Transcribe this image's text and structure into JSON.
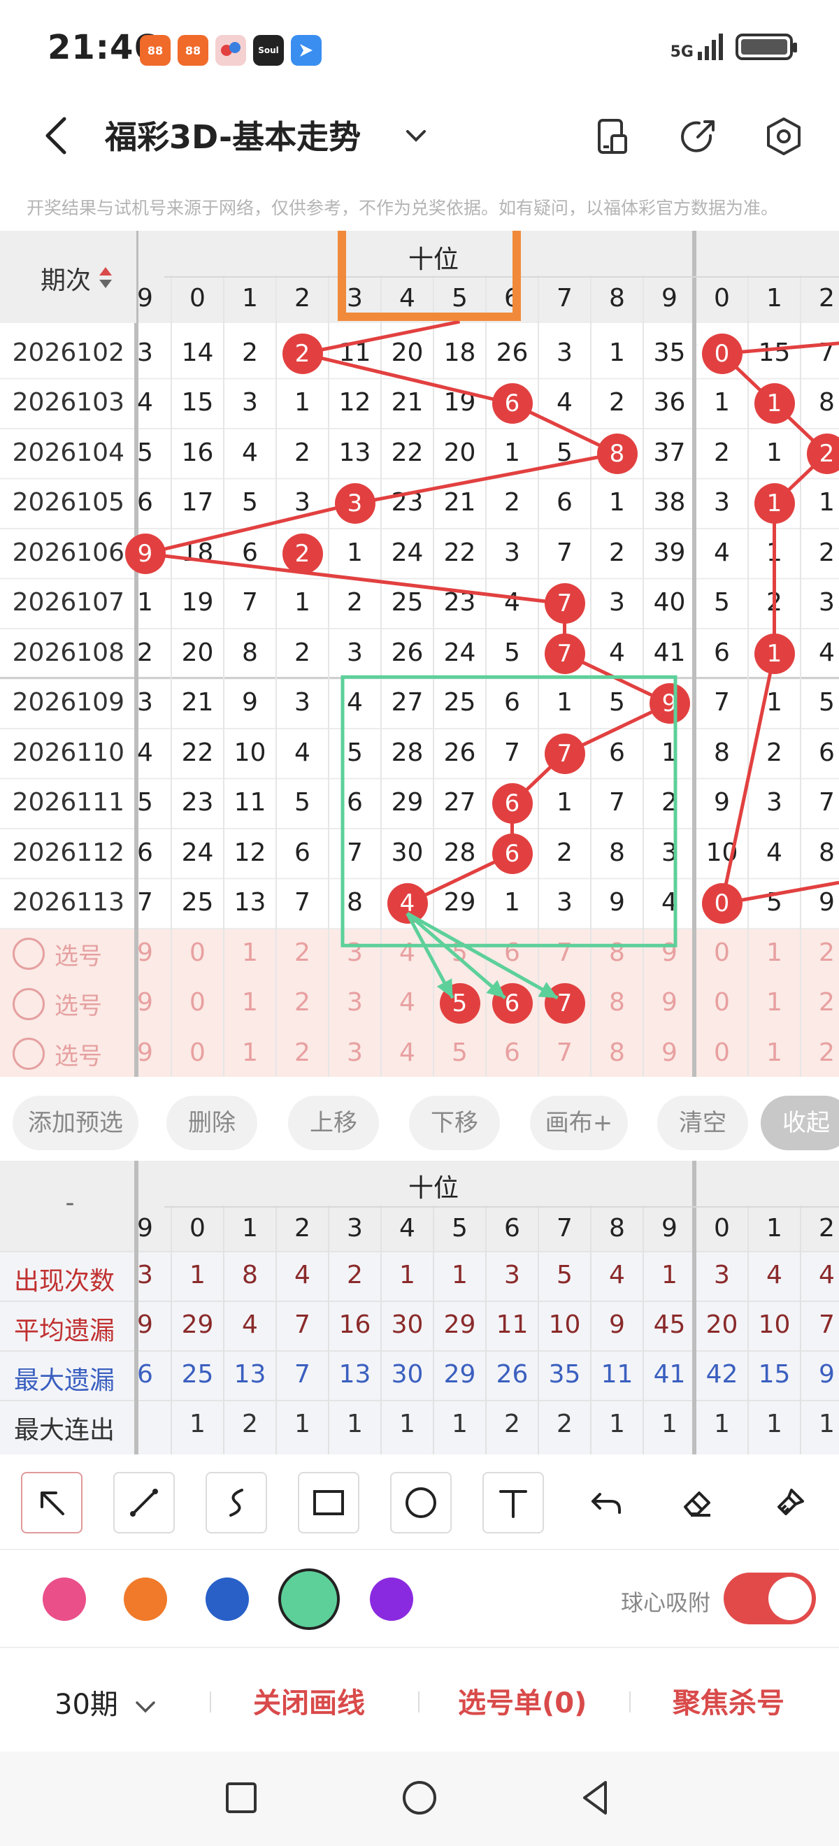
{
  "status_bar": {
    "time": "21:46",
    "network": "5G",
    "app_icons": [
      "app-icon-1",
      "app-icon-2",
      "app-icon-3",
      "soul-app-icon",
      "feishu-app-icon"
    ]
  },
  "header": {
    "title": "福彩3D-基本走势"
  },
  "notice": "开奖结果与试机号来源于网络，仅供参考，不作为兑奖依据。如有疑问，以福体彩官方数据为准。",
  "chart": {
    "period_header": "期次",
    "section_label": "十位",
    "digit_headers": [
      "9",
      "0",
      "1",
      "2",
      "3",
      "4",
      "5",
      "6",
      "7",
      "8",
      "9",
      "0",
      "1",
      "2"
    ],
    "rows": [
      {
        "period": "2026102",
        "cells": [
          "3",
          "14",
          "2",
          "2",
          "11",
          "20",
          "18",
          "26",
          "3",
          "1",
          "35",
          "0",
          "15",
          "7"
        ]
      },
      {
        "period": "2026103",
        "cells": [
          "4",
          "15",
          "3",
          "1",
          "12",
          "21",
          "19",
          "6",
          "4",
          "2",
          "36",
          "1",
          "1",
          "8"
        ]
      },
      {
        "period": "2026104",
        "cells": [
          "5",
          "16",
          "4",
          "2",
          "13",
          "22",
          "20",
          "1",
          "5",
          "8",
          "37",
          "2",
          "1",
          "2"
        ]
      },
      {
        "period": "2026105",
        "cells": [
          "6",
          "17",
          "5",
          "3",
          "3",
          "23",
          "21",
          "2",
          "6",
          "1",
          "38",
          "3",
          "1",
          "1"
        ]
      },
      {
        "period": "2026106",
        "cells": [
          "9",
          "18",
          "6",
          "2",
          "1",
          "24",
          "22",
          "3",
          "7",
          "2",
          "39",
          "4",
          "1",
          "2"
        ]
      },
      {
        "period": "2026107",
        "cells": [
          "1",
          "19",
          "7",
          "1",
          "2",
          "25",
          "23",
          "4",
          "7",
          "3",
          "40",
          "5",
          "2",
          "3"
        ]
      },
      {
        "period": "2026108",
        "cells": [
          "2",
          "20",
          "8",
          "2",
          "3",
          "26",
          "24",
          "5",
          "7",
          "4",
          "41",
          "6",
          "1",
          "4"
        ]
      },
      {
        "period": "2026109",
        "cells": [
          "3",
          "21",
          "9",
          "3",
          "4",
          "27",
          "25",
          "6",
          "1",
          "5",
          "9",
          "7",
          "1",
          "5"
        ]
      },
      {
        "period": "2026110",
        "cells": [
          "4",
          "22",
          "10",
          "4",
          "5",
          "28",
          "26",
          "7",
          "7",
          "6",
          "1",
          "8",
          "2",
          "6"
        ]
      },
      {
        "period": "2026111",
        "cells": [
          "5",
          "23",
          "11",
          "5",
          "6",
          "29",
          "27",
          "6",
          "1",
          "7",
          "2",
          "9",
          "3",
          "7"
        ]
      },
      {
        "period": "2026112",
        "cells": [
          "6",
          "24",
          "12",
          "6",
          "7",
          "30",
          "28",
          "6",
          "2",
          "8",
          "3",
          "10",
          "4",
          "8"
        ]
      },
      {
        "period": "2026113",
        "cells": [
          "7",
          "25",
          "13",
          "7",
          "8",
          "4",
          "29",
          "1",
          "3",
          "9",
          "4",
          "0",
          "5",
          "9"
        ]
      }
    ],
    "balls": [
      {
        "row": 0,
        "col": 3,
        "value": "2"
      },
      {
        "row": 0,
        "col": 11,
        "value": "0"
      },
      {
        "row": 1,
        "col": 7,
        "value": "6"
      },
      {
        "row": 1,
        "col": 12,
        "value": "1"
      },
      {
        "row": 2,
        "col": 9,
        "value": "8"
      },
      {
        "row": 2,
        "col": 13,
        "value": "2"
      },
      {
        "row": 3,
        "col": 4,
        "value": "3"
      },
      {
        "row": 3,
        "col": 12,
        "value": "1"
      },
      {
        "row": 4,
        "col": 0,
        "value": "9"
      },
      {
        "row": 4,
        "col": 3,
        "value": "2"
      },
      {
        "row": 5,
        "col": 8,
        "value": "7"
      },
      {
        "row": 6,
        "col": 8,
        "value": "7"
      },
      {
        "row": 6,
        "col": 12,
        "value": "1"
      },
      {
        "row": 7,
        "col": 10,
        "value": "9"
      },
      {
        "row": 8,
        "col": 8,
        "value": "7"
      },
      {
        "row": 9,
        "col": 7,
        "value": "6"
      },
      {
        "row": 10,
        "col": 7,
        "value": "6"
      },
      {
        "row": 11,
        "col": 5,
        "value": "4"
      },
      {
        "row": 11,
        "col": 11,
        "value": "0"
      }
    ],
    "pick_rows": [
      {
        "label": "选号",
        "cells": [
          "9",
          "0",
          "1",
          "2",
          "3",
          "4",
          "5",
          "6",
          "7",
          "8",
          "9",
          "0",
          "1",
          "2"
        ]
      },
      {
        "label": "选号",
        "cells": [
          "9",
          "0",
          "1",
          "2",
          "3",
          "4",
          "5",
          "6",
          "7",
          "8",
          "9",
          "0",
          "1",
          "2"
        ]
      },
      {
        "label": "选号",
        "cells": [
          "9",
          "0",
          "1",
          "2",
          "3",
          "4",
          "5",
          "6",
          "7",
          "8",
          "9",
          "0",
          "1",
          "2"
        ]
      }
    ],
    "pick_balls": [
      {
        "row": 1,
        "col": 6,
        "value": "5"
      },
      {
        "row": 1,
        "col": 7,
        "value": "6"
      },
      {
        "row": 1,
        "col": 8,
        "value": "7"
      }
    ]
  },
  "actions": {
    "add": "添加预选",
    "delete": "删除",
    "up": "上移",
    "down": "下移",
    "draw": "画布+",
    "clear": "清空",
    "collapse": "收起"
  },
  "stats": {
    "section_label": "十位",
    "corner": "-",
    "digit_headers": [
      "9",
      "0",
      "1",
      "2",
      "3",
      "4",
      "5",
      "6",
      "7",
      "8",
      "9",
      "0",
      "1",
      "2"
    ],
    "rows": [
      {
        "label": "出现次数",
        "color": "#c03030",
        "cells": [
          "3",
          "1",
          "8",
          "4",
          "2",
          "1",
          "1",
          "3",
          "5",
          "4",
          "1",
          "3",
          "4",
          "4"
        ]
      },
      {
        "label": "平均遗漏",
        "color": "#c03030",
        "cells": [
          "9",
          "29",
          "4",
          "7",
          "16",
          "30",
          "29",
          "11",
          "10",
          "9",
          "45",
          "20",
          "10",
          "7"
        ]
      },
      {
        "label": "最大遗漏",
        "color": "#3a5fbf",
        "cells": [
          "6",
          "25",
          "13",
          "7",
          "13",
          "30",
          "29",
          "26",
          "35",
          "11",
          "41",
          "42",
          "15",
          "9"
        ]
      },
      {
        "label": "最大连出",
        "color": "#333333",
        "cells": [
          "",
          "1",
          "2",
          "1",
          "1",
          "1",
          "1",
          "2",
          "2",
          "1",
          "1",
          "1",
          "1",
          "1"
        ]
      }
    ]
  },
  "palette": {
    "colors": [
      "#ea4f8a",
      "#f07a2a",
      "#2860c8",
      "#5dd09a",
      "#8a2ae0"
    ],
    "selected": "#5dd09a",
    "snap_label": "球心吸附",
    "snap_on": true
  },
  "bottom_bar": {
    "period": "30期",
    "close_lines": "关闭画线",
    "pick_list": "选号单(0)",
    "focus_kill": "聚焦杀号"
  },
  "annotation_colors": {
    "orange_box": "#f08a3a",
    "green_box": "#5dd09a",
    "ball_red": "#e24040"
  }
}
